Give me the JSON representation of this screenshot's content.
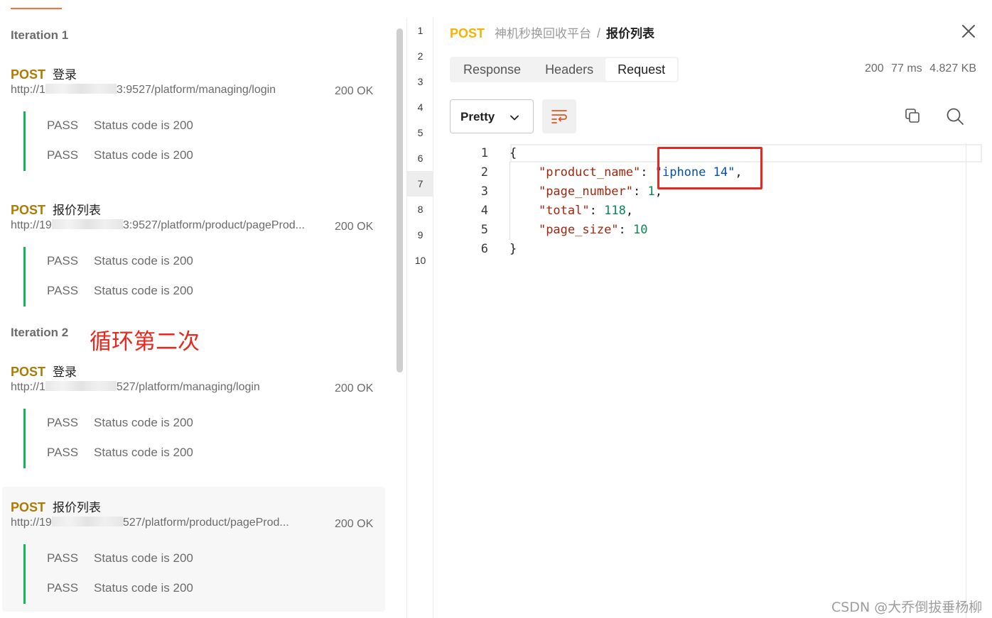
{
  "colors": {
    "accent": "#ff6c37",
    "pass_bar": "#0cbb52",
    "method_left": "#ad7a03",
    "method_right": "#f4b400",
    "annotation": "#e8281e"
  },
  "annotation": "循环第二次",
  "iterations": [
    {
      "title": "Iteration 1",
      "requests": [
        {
          "method": "POST",
          "name": "登录",
          "url_prefix": "http://1",
          "url_suffix": "3:9527/platform/managing/login",
          "status": "200 OK",
          "tests": [
            {
              "result": "PASS",
              "name": "Status code is 200"
            },
            {
              "result": "PASS",
              "name": "Status code is 200"
            }
          ]
        },
        {
          "method": "POST",
          "name": "报价列表",
          "url_prefix": "http://19",
          "url_suffix": "3:9527/platform/product/pageProd...",
          "status": "200 OK",
          "tests": [
            {
              "result": "PASS",
              "name": "Status code is 200"
            },
            {
              "result": "PASS",
              "name": "Status code is 200"
            }
          ]
        }
      ]
    },
    {
      "title": "Iteration 2",
      "requests": [
        {
          "method": "POST",
          "name": "登录",
          "url_prefix": "http://1",
          "url_suffix": "527/platform/managing/login",
          "status": "200 OK",
          "tests": [
            {
              "result": "PASS",
              "name": "Status code is 200"
            },
            {
              "result": "PASS",
              "name": "Status code is 200"
            }
          ]
        },
        {
          "method": "POST",
          "name": "报价列表",
          "url_prefix": "http://19",
          "url_suffix": "527/platform/product/pageProd...",
          "status": "200 OK",
          "tests": [
            {
              "result": "PASS",
              "name": "Status code is 200"
            },
            {
              "result": "PASS",
              "name": "Status code is 200"
            }
          ]
        }
      ]
    }
  ],
  "gutter": {
    "lines": [
      "1",
      "2",
      "3",
      "4",
      "5",
      "6",
      "7",
      "8",
      "9",
      "10"
    ],
    "active_line": "7"
  },
  "detail": {
    "method": "POST",
    "collection": "神机秒换回收平台",
    "separator": "/",
    "request_name": "报价列表",
    "tabs": [
      "Response",
      "Headers",
      "Request"
    ],
    "active_tab": "Request",
    "status_code": "200",
    "time": "77 ms",
    "size": "4.827 KB",
    "format_select": "Pretty",
    "icons": {
      "close": "close-icon",
      "wrap": "wrap-lines-icon",
      "copy": "copy-icon",
      "search": "search-icon",
      "chevron": "chevron-down-icon"
    }
  },
  "code": {
    "line_numbers": [
      "1",
      "2",
      "3",
      "4",
      "5",
      "6"
    ],
    "open_brace": "{",
    "close_brace": "}",
    "fields": [
      {
        "key": "\"product_name\"",
        "value": "\"iphone 14\"",
        "type": "string",
        "comma": ","
      },
      {
        "key": "\"page_number\"",
        "value": "1",
        "type": "number",
        "comma": ","
      },
      {
        "key": "\"total\"",
        "value": "118",
        "type": "number",
        "comma": ","
      },
      {
        "key": "\"page_size\"",
        "value": "10",
        "type": "number",
        "comma": ""
      }
    ]
  },
  "watermark": "CSDN @大乔倒拔垂杨柳"
}
